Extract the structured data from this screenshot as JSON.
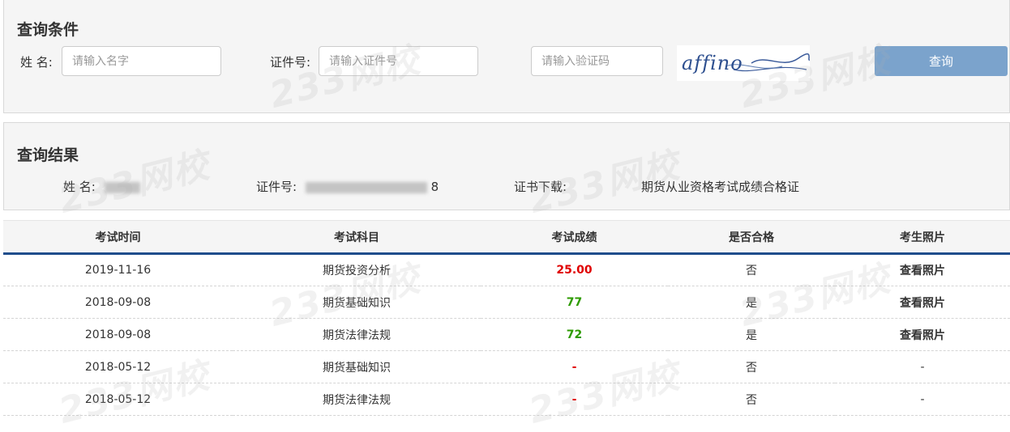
{
  "query": {
    "title": "查询条件",
    "name_label": "姓 名:",
    "name_placeholder": "请输入名字",
    "id_label": "证件号:",
    "id_placeholder": "请输入证件号",
    "captcha_placeholder": "请输入验证码",
    "captcha_text": "affino",
    "button_label": "查询"
  },
  "result": {
    "title": "查询结果",
    "name_label": "姓 名:",
    "id_label": "证件号:",
    "id_tail": "8",
    "cert_label": "证书下载:",
    "cert_value": "期货从业资格考试成绩合格证"
  },
  "table": {
    "headers": [
      "考试时间",
      "考试科目",
      "考试成绩",
      "是否合格",
      "考生照片"
    ],
    "rows": [
      {
        "date": "2019-11-16",
        "subject": "期货投资分析",
        "score": "25.00",
        "score_color": "#e00000",
        "passed": "否",
        "photo": "查看照片"
      },
      {
        "date": "2018-09-08",
        "subject": "期货基础知识",
        "score": "77",
        "score_color": "#2e9b00",
        "passed": "是",
        "photo": "查看照片"
      },
      {
        "date": "2018-09-08",
        "subject": "期货法律法规",
        "score": "72",
        "score_color": "#2e9b00",
        "passed": "是",
        "photo": "查看照片"
      },
      {
        "date": "2018-05-12",
        "subject": "期货基础知识",
        "score": "-",
        "score_color": "#e00000",
        "passed": "否",
        "photo": "-"
      },
      {
        "date": "2018-05-12",
        "subject": "期货法律法规",
        "score": "-",
        "score_color": "#e00000",
        "passed": "否",
        "photo": "-"
      }
    ]
  },
  "watermark_text": "233网校",
  "colors": {
    "button": "#7ba3cc",
    "header_border": "#1f4d8c",
    "fail": "#e00000",
    "pass": "#2e9b00"
  }
}
